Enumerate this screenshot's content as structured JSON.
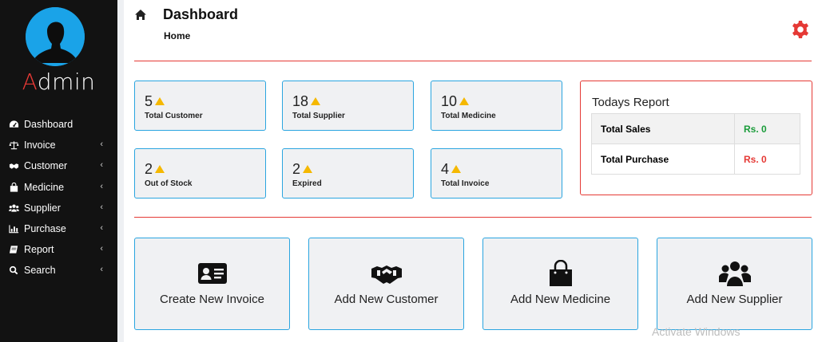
{
  "brand": {
    "first_letter": "A",
    "rest": "dmin"
  },
  "sidebar": {
    "items": [
      {
        "label": "Dashboard",
        "icon": "tachometer-icon",
        "has_submenu": false
      },
      {
        "label": "Invoice",
        "icon": "balance-scale-icon",
        "has_submenu": true
      },
      {
        "label": "Customer",
        "icon": "handshake-icon",
        "has_submenu": true
      },
      {
        "label": "Medicine",
        "icon": "shopping-bag-icon",
        "has_submenu": true
      },
      {
        "label": "Supplier",
        "icon": "users-icon",
        "has_submenu": true
      },
      {
        "label": "Purchase",
        "icon": "bar-chart-icon",
        "has_submenu": true
      },
      {
        "label": "Report",
        "icon": "book-icon",
        "has_submenu": true
      },
      {
        "label": "Search",
        "icon": "search-icon",
        "has_submenu": true
      }
    ],
    "chevron": "‹"
  },
  "header": {
    "title": "Dashboard",
    "breadcrumb": "Home"
  },
  "stats": [
    {
      "value": "5",
      "label": "Total Customer"
    },
    {
      "value": "18",
      "label": "Total Supplier"
    },
    {
      "value": "10",
      "label": "Total Medicine"
    },
    {
      "value": "2",
      "label": "Out of Stock"
    },
    {
      "value": "2",
      "label": "Expired"
    },
    {
      "value": "4",
      "label": "Total Invoice"
    }
  ],
  "report": {
    "title": "Todays Report",
    "rows": [
      {
        "label": "Total Sales",
        "value": "Rs. 0",
        "color": "#1a9c3a"
      },
      {
        "label": "Total Purchase",
        "value": "Rs. 0",
        "color": "#e53935"
      }
    ]
  },
  "actions": [
    {
      "label": "Create New Invoice",
      "icon": "id-card-icon"
    },
    {
      "label": "Add New Customer",
      "icon": "handshake-icon"
    },
    {
      "label": "Add New Medicine",
      "icon": "shopping-bag-icon"
    },
    {
      "label": "Add New Supplier",
      "icon": "users-icon"
    }
  ],
  "watermark": "Activate Windows",
  "colors": {
    "accent_red": "#e53935",
    "border_blue": "#2aa5e0",
    "warning_yellow": "#f5b800",
    "sidebar_bg": "#121212"
  }
}
